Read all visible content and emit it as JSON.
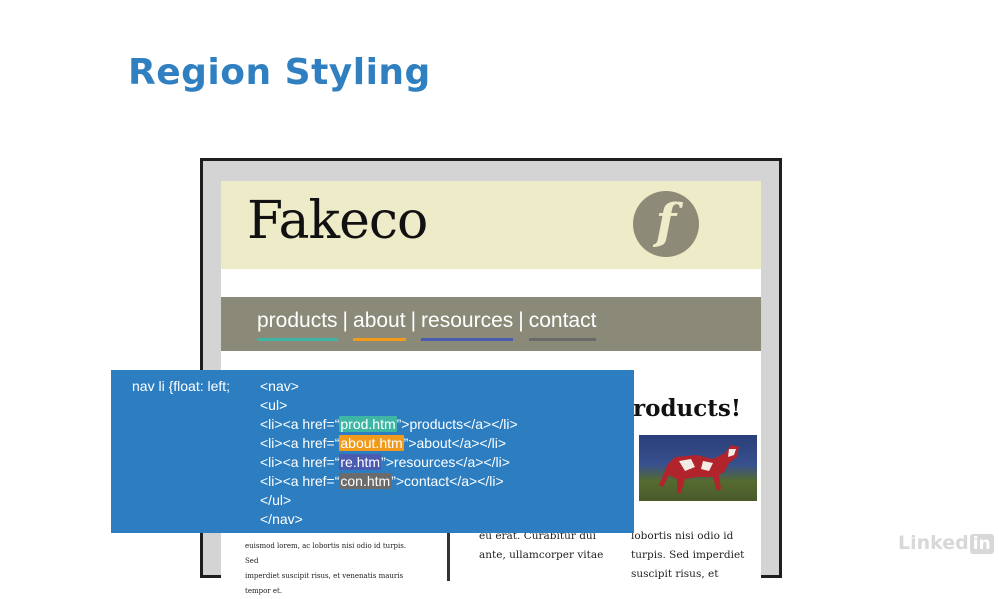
{
  "slide": {
    "title": "Region Styling"
  },
  "mockup": {
    "brand": "Fakeco",
    "logo_letter": "f",
    "nav": {
      "items": [
        {
          "label": "products",
          "underline": "#3fb6a4"
        },
        {
          "label": "about",
          "underline": "#f29a1b"
        },
        {
          "label": "resources",
          "underline": "#4a5bb0"
        },
        {
          "label": "contact",
          "underline": "#6a6a6a"
        }
      ],
      "separator": "|"
    },
    "content_heading": "roducts!",
    "columns": {
      "a": [
        "euismod lorem, ac lobortis nisi odio id turpis. Sed",
        "imperdiet suscipit risus, et venenatis mauris tempor et."
      ],
      "b": [
        "eu erat. Curabitur dui",
        "ante, ullamcorper vitae"
      ],
      "c": [
        "lobortis nisi odio id",
        "turpis. Sed imperdiet",
        "suscipit risus, et"
      ]
    }
  },
  "code": {
    "css_rule": "nav li {float: left;",
    "nav_open": "<nav>",
    "ul_open": "<ul>",
    "lines": [
      {
        "prefix": "<li><a href=“",
        "file": "prod.htm",
        "suffix": "”>products</a></li>"
      },
      {
        "prefix": "<li><a href=“",
        "file": "about.htm",
        "suffix": "”>about</a></li>"
      },
      {
        "prefix": "<li><a href=“",
        "file": "re.htm",
        "suffix": "”>resources</a></li>"
      },
      {
        "prefix": "<li><a href=“",
        "file": "con.htm",
        "suffix": "”>contact</a></li>"
      }
    ],
    "ul_close": "</ul>",
    "nav_close": "</nav>"
  },
  "colors": {
    "title": "#2f7fc1",
    "code_bg": "#2c7ec1",
    "header_bg": "#eeebc9",
    "nav_bg": "#8b8978"
  },
  "watermark": {
    "text": "Linked",
    "badge": "in"
  }
}
